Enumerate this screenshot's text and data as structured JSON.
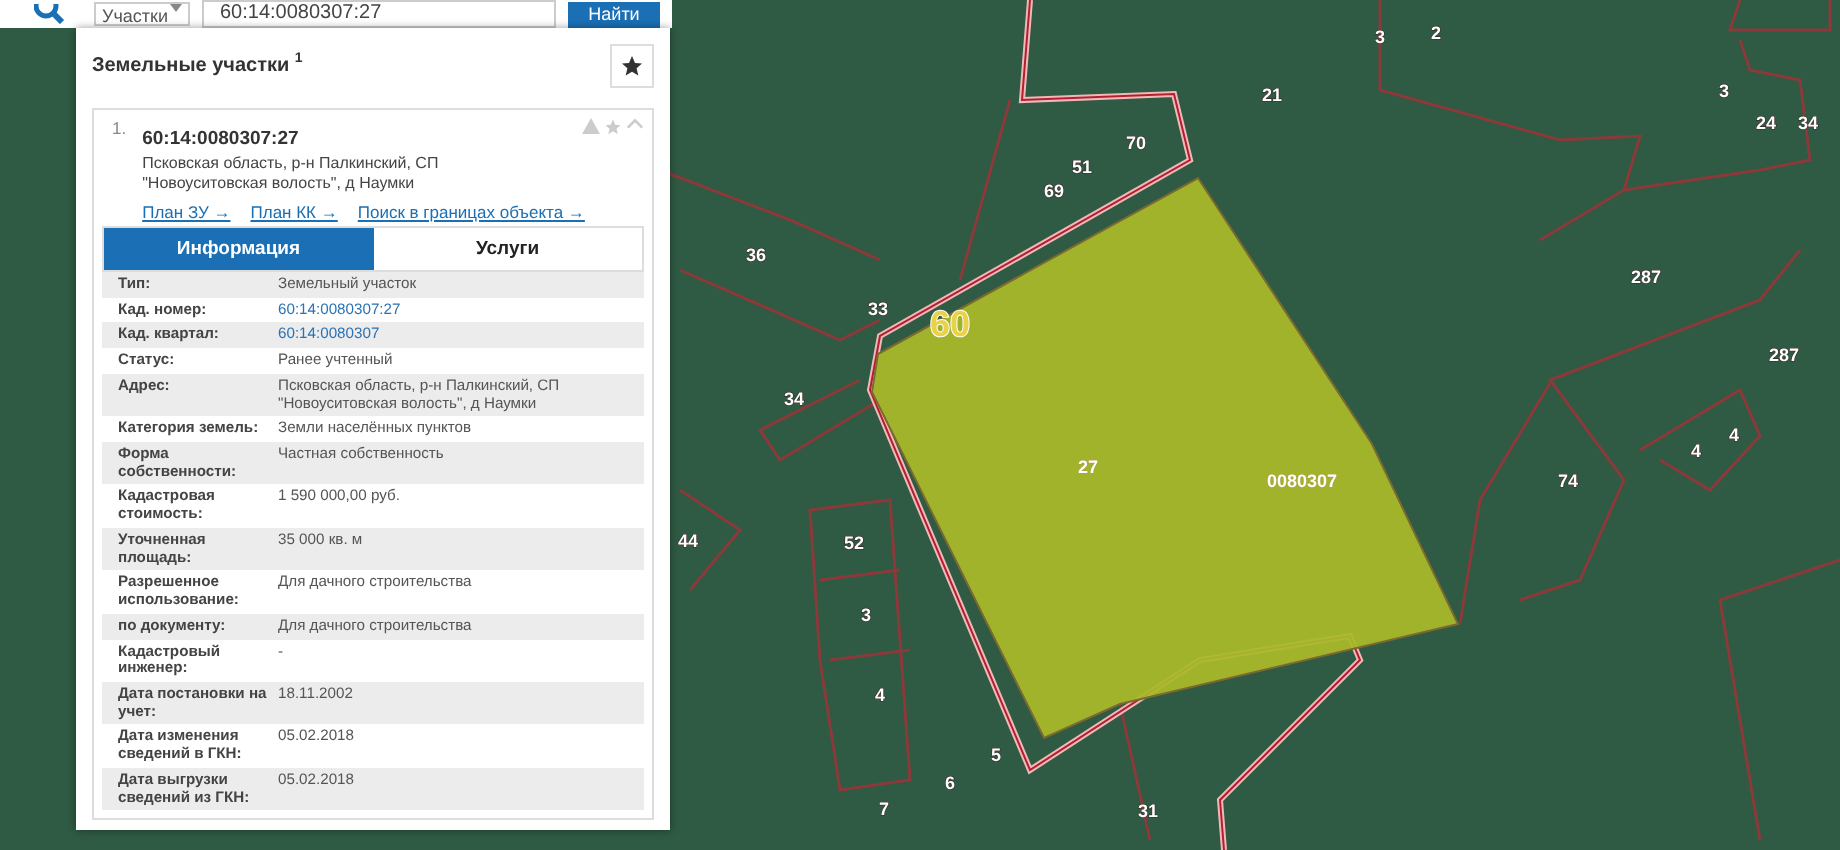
{
  "search_bar": {
    "category": "Участки",
    "query": "60:14:0080307:27",
    "button": "Найти"
  },
  "results": {
    "title": "Земельные участки $^{1}$",
    "item": {
      "index": "1.",
      "number": "60:14:0080307:27",
      "address": "Псковская область, р-н Палкинский, СП \"Новоуситовская волость\", д Наумки",
      "links": [
        "План ЗУ →",
        "План КК →",
        "Поиск в границах объекта →"
      ],
      "tabs": [
        {
          "label": "Информация",
          "selected": true
        },
        {
          "label": "Услуги",
          "selected": false
        }
      ],
      "rows": [
        {
          "label": "Тип:",
          "value": "Земельный участок",
          "kind": "text"
        },
        {
          "label": "Кад. номер:",
          "value": "60:14:0080307:27",
          "kind": "link"
        },
        {
          "label": "Кад. квартал:",
          "value": "60:14:0080307",
          "kind": "link"
        },
        {
          "label": "Статус:",
          "value": "Ранее учтенный",
          "kind": "text"
        },
        {
          "label": "Адрес:",
          "value": "Псковская область, р-н Палкинский, СП \"Новоуситовская волость\", д Наумки",
          "kind": "text"
        },
        {
          "label": "Категория земель:",
          "value": "Земли населённых пунктов",
          "kind": "text"
        },
        {
          "label": "Форма собственности:",
          "value": "Частная собственность",
          "kind": "text"
        },
        {
          "label": "Кадастровая стоимость:",
          "value": "1 590 000,00 руб.",
          "kind": "text"
        },
        {
          "label": "Уточненная площадь:",
          "value": "35 000 кв. м",
          "kind": "text"
        },
        {
          "label": "Разрешенное использование:",
          "value": "Для дачного строительства",
          "kind": "text"
        },
        {
          "label": "по документу:",
          "value": "Для дачного строительства",
          "kind": "text"
        },
        {
          "label": "Кадастровый инженер:",
          "value": "-",
          "kind": "text"
        },
        {
          "label": "Дата постановки на учет:",
          "value": "18.11.2002",
          "kind": "text"
        },
        {
          "label": "Дата изменения сведений в ГКН:",
          "value": "05.02.2018",
          "kind": "text"
        },
        {
          "label": "Дата выгрузки сведений из ГКН:",
          "value": "05.02.2018",
          "kind": "text"
        }
      ]
    }
  },
  "map": {
    "labels": [
      {
        "text": "60",
        "kind": "quarter"
      },
      {
        "text": "27",
        "kind": "selected"
      },
      {
        "text": "0080307",
        "kind": "selected"
      },
      {
        "text": "21",
        "kind": "parcel"
      },
      {
        "text": "70",
        "kind": "parcel"
      },
      {
        "text": "51",
        "kind": "parcel"
      },
      {
        "text": "69",
        "kind": "parcel"
      },
      {
        "text": "36",
        "kind": "parcel"
      },
      {
        "text": "33",
        "kind": "parcel"
      },
      {
        "text": "34",
        "kind": "parcel"
      },
      {
        "text": "3",
        "kind": "parcel"
      },
      {
        "text": "2",
        "kind": "parcel"
      },
      {
        "text": "3",
        "kind": "parcel"
      },
      {
        "text": "24",
        "kind": "parcel"
      },
      {
        "text": "34",
        "kind": "parcel"
      },
      {
        "text": "287",
        "kind": "parcel"
      },
      {
        "text": "287",
        "kind": "parcel"
      },
      {
        "text": "4",
        "kind": "parcel"
      },
      {
        "text": "4",
        "kind": "parcel"
      },
      {
        "text": "74",
        "kind": "parcel"
      },
      {
        "text": "44",
        "kind": "parcel"
      },
      {
        "text": "52",
        "kind": "parcel"
      },
      {
        "text": "3",
        "kind": "parcel"
      },
      {
        "text": "4",
        "kind": "parcel"
      },
      {
        "text": "5",
        "kind": "parcel"
      },
      {
        "text": "6",
        "kind": "parcel"
      },
      {
        "text": "7",
        "kind": "parcel"
      },
      {
        "text": "31",
        "kind": "parcel"
      }
    ]
  }
}
